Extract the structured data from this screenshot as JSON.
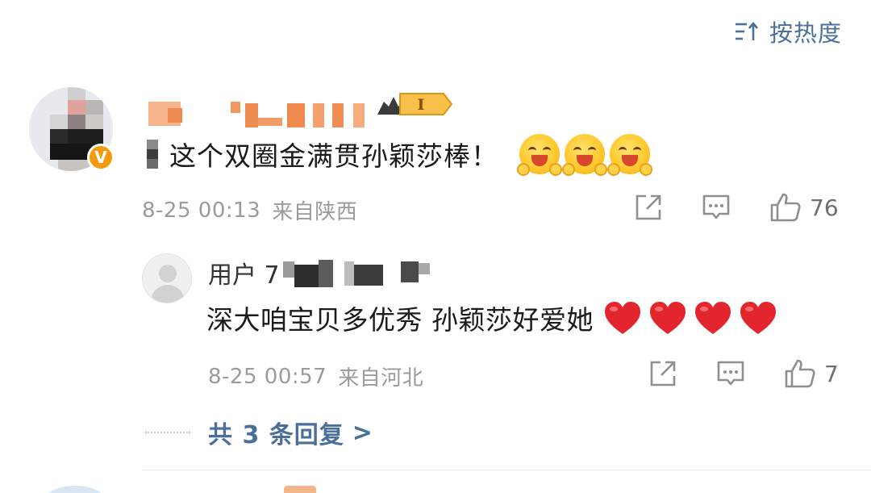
{
  "sort": {
    "label": "按热度",
    "icon": "sort-descending-icon"
  },
  "comment": {
    "user": {
      "avatar_icon": "user-avatar",
      "verified_badge": "V",
      "level_badge": "I"
    },
    "text": "这个双圈金满贯孙颖莎棒！",
    "emojis": [
      "cheering-emoji",
      "cheering-emoji",
      "cheering-emoji"
    ],
    "time": "8-25 00:13",
    "location": "来自陕西",
    "likes": "76"
  },
  "reply": {
    "user": {
      "name_prefix": "用户 7",
      "avatar_icon": "default-avatar"
    },
    "text": "深大咱宝贝多优秀 孙颖莎好爱她",
    "hearts": [
      "red-heart-emoji",
      "red-heart-emoji",
      "red-heart-emoji",
      "red-heart-emoji"
    ],
    "time": "8-25 00:57",
    "location": "来自河北",
    "likes": "7"
  },
  "more_replies": {
    "label": "共 3 条回复",
    "chevron": ">"
  },
  "colors": {
    "link_blue": "#4a6f9a",
    "meta_gray": "#9b9b9b",
    "heart_red": "#e3262d",
    "badge_orange": "#f39a0d"
  }
}
